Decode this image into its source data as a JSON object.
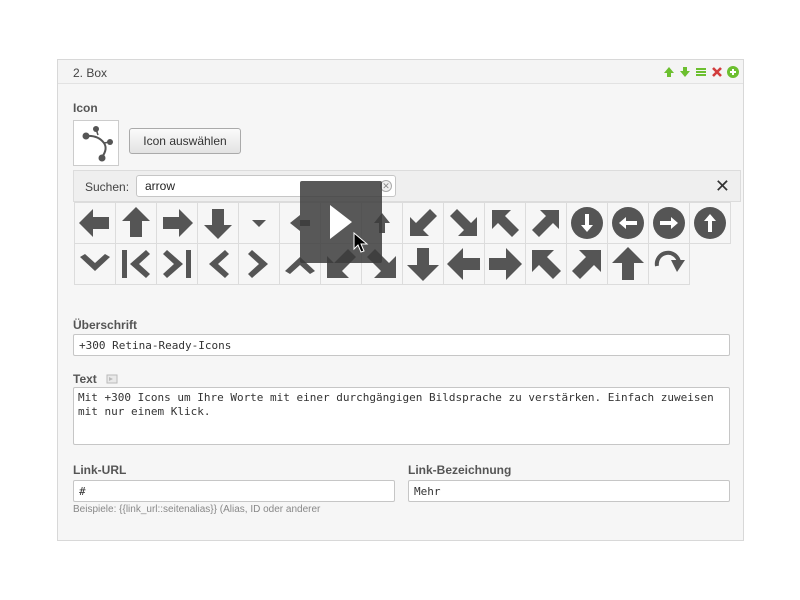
{
  "box": {
    "title": "2. Box",
    "header_icons": [
      "move-up-icon",
      "move-down-icon",
      "reorder-icon",
      "delete-icon",
      "add-icon"
    ]
  },
  "icon_section": {
    "label": "Icon",
    "preview_icon": "bezier-icon",
    "select_button": "Icon auswählen"
  },
  "search": {
    "label": "Suchen:",
    "value": "arrow",
    "close_symbol": "✕"
  },
  "icon_grid": {
    "row1": [
      "arrow-left-bold-icon",
      "arrow-up-bold-icon",
      "arrow-right-bold-icon",
      "arrow-down-bold-icon",
      "caret-down-icon",
      "arrow-left-small-icon",
      "hidden-icon",
      "arrow-up-small-icon",
      "arrow-down-left-icon",
      "arrow-down-right-icon",
      "arrow-up-left-icon",
      "arrow-up-right-icon",
      "circle-arrow-down-icon",
      "circle-arrow-left-icon",
      "circle-arrow-right-icon",
      "circle-arrow-up-icon"
    ],
    "row2": [
      "chevron-down-icon",
      "step-backward-icon",
      "step-forward-icon",
      "chevron-left-icon",
      "chevron-right-icon",
      "chevron-up-icon",
      "arrow-down-left-large-icon",
      "arrow-down-right-large-icon",
      "arrow-down-large-icon",
      "arrow-left-large-icon",
      "arrow-right-large-icon",
      "arrow-up-left-large-icon",
      "arrow-up-right-large-icon",
      "arrow-up-large-icon",
      "redo-icon"
    ]
  },
  "overlay_icon": "play-icon",
  "headline": {
    "label": "Überschrift",
    "value": "+300 Retina-Ready-Icons"
  },
  "text": {
    "label": "Text",
    "value": "Mit +300 Icons um Ihre Worte mit einer durchgängigen Bildsprache zu verstärken. Einfach zuweisen mit nur einem Klick."
  },
  "link_url": {
    "label": "Link-URL",
    "value": "#",
    "hint": "Beispiele: {{link_url::seitenalias}} (Alias, ID oder anderer"
  },
  "link_label": {
    "label": "Link-Bezeichnung",
    "value": "Mehr"
  },
  "colors": {
    "accent_green": "#6cbf2f",
    "delete_red": "#d23c3c",
    "icon_gray": "#555555"
  }
}
